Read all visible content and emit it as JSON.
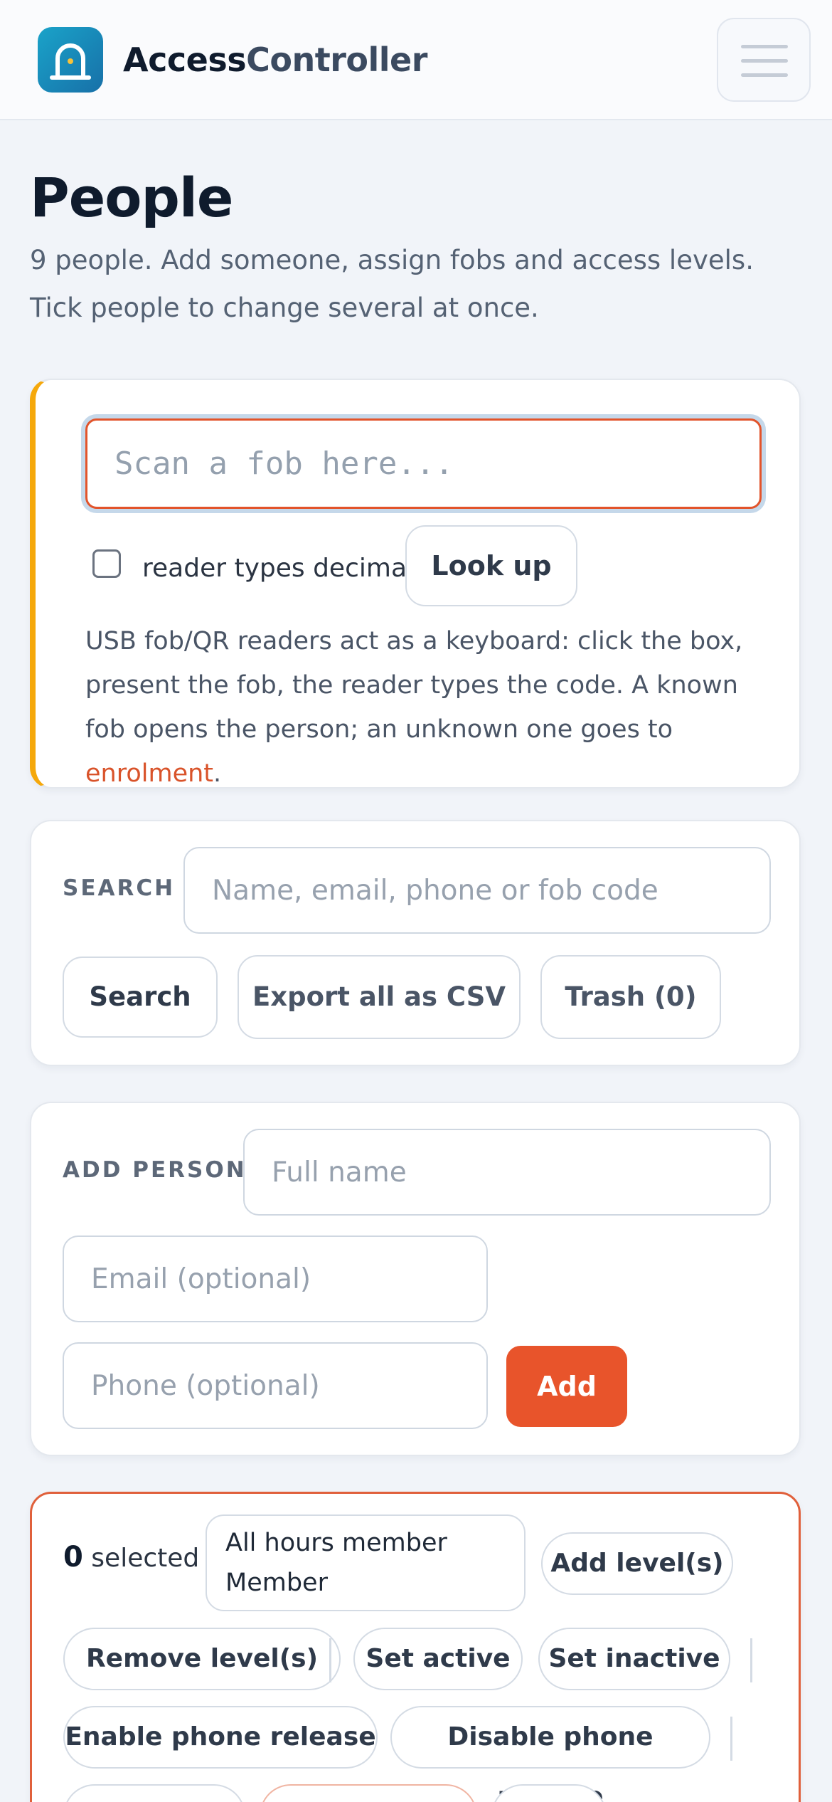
{
  "header": {
    "brand_part1": "Access",
    "brand_part2": "Controller",
    "logo_icon": "lock-door-icon",
    "menu_icon": "hamburger-menu-icon"
  },
  "page": {
    "title": "People",
    "subtitle": "9 people. Add someone, assign fobs and access levels. Tick people to change several at once."
  },
  "scan": {
    "placeholder": "Scan a fob here...",
    "checkbox_label": "reader types decimal",
    "checkbox_checked": false,
    "lookup_label": "Look up",
    "help_text": "USB fob/QR readers act as a keyboard: click the box, present the fob, the reader types the code. A known fob opens the person; an unknown one goes to ",
    "help_link": "enrolment",
    "help_end": "."
  },
  "search": {
    "label": "SEARCH",
    "placeholder": "Name, email, phone or fob code",
    "search_label": "Search",
    "export_label": "Export all as CSV",
    "trash_label": "Trash (0)"
  },
  "add_person": {
    "label": "ADD PERSON",
    "name_placeholder": "Full name",
    "email_placeholder": "Email (optional)",
    "phone_placeholder": "Phone (optional)",
    "add_label": "Add"
  },
  "bulk": {
    "selected_count": "0",
    "selected_label": "selected",
    "level_options": [
      "All hours member",
      "Member"
    ],
    "add_levels": "Add level(s)",
    "remove_levels": "Remove level(s)",
    "set_active": "Set active",
    "set_inactive": "Set inactive",
    "enable_phone": "Enable phone release",
    "disable_phone": "Disable phone release"
  },
  "colors": {
    "accent": "#e8542b",
    "scan_border": "#f5a80b",
    "logo": "#1a8fc4"
  }
}
